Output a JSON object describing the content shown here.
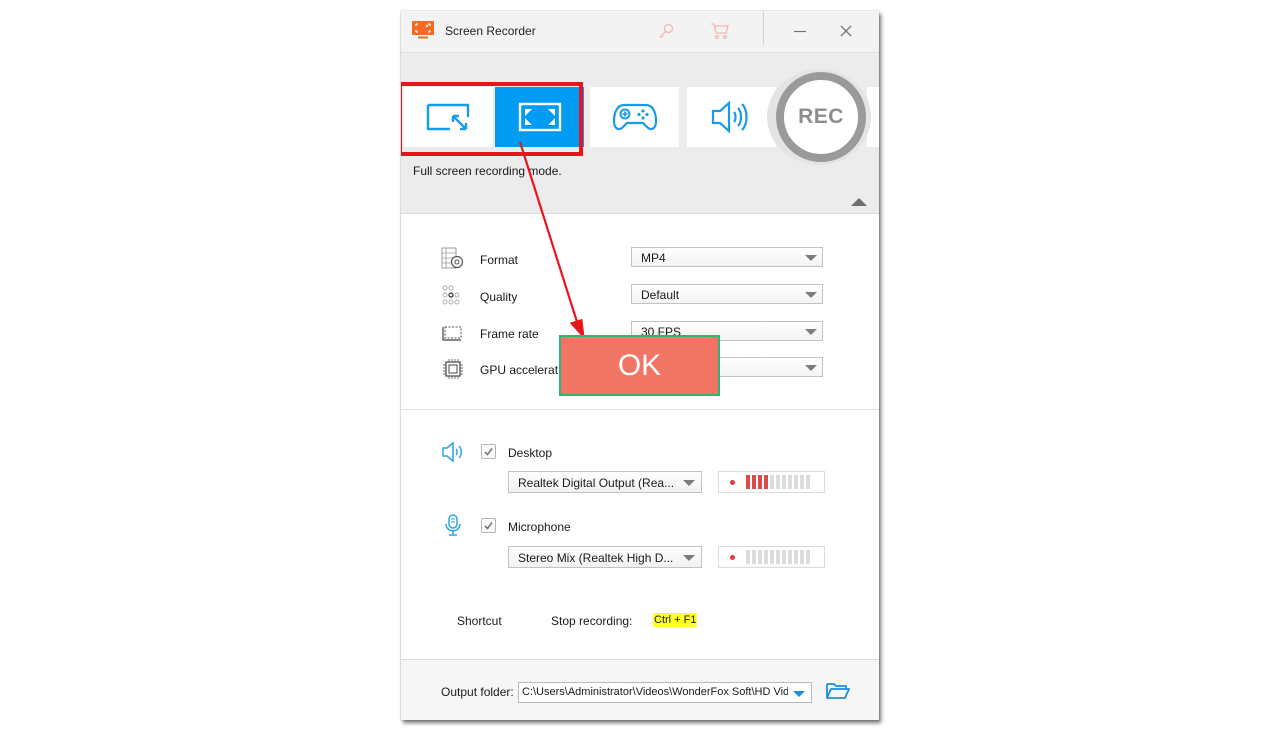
{
  "window": {
    "title": "Screen Recorder",
    "titlebar_icons": [
      "key-icon",
      "cart-icon",
      "minimize-icon",
      "close-icon"
    ]
  },
  "modes": {
    "items": [
      {
        "name": "region-mode",
        "icon": "region-resize-icon",
        "active": false
      },
      {
        "name": "fullscreen-mode",
        "icon": "fullscreen-icon",
        "active": true
      },
      {
        "name": "game-mode",
        "icon": "gamepad-icon",
        "active": false
      },
      {
        "name": "audio-mode",
        "icon": "speaker-icon",
        "active": false
      }
    ],
    "rec_label": "REC",
    "description": "Full screen recording mode."
  },
  "settings": {
    "format": {
      "label": "Format",
      "value": "MP4"
    },
    "quality": {
      "label": "Quality",
      "value": "Default"
    },
    "frame_rate": {
      "label": "Frame rate",
      "value": "30 FPS"
    },
    "gpu": {
      "label": "GPU accelerat",
      "value": ""
    }
  },
  "audio": {
    "desktop": {
      "label": "Desktop",
      "checked": true,
      "device": "Realtek Digital Output (Rea...",
      "level_segments_on": 4,
      "level_segments_total": 11
    },
    "microphone": {
      "label": "Microphone",
      "checked": true,
      "device": "Stereo Mix (Realtek High D...",
      "level_segments_on": 0,
      "level_segments_total": 11
    }
  },
  "shortcut": {
    "label": "Shortcut",
    "stop_label": "Stop recording:",
    "stop_key": "Ctrl + F1"
  },
  "output": {
    "label": "Output folder:",
    "path": "C:\\Users\\Administrator\\Videos\\WonderFox Soft\\HD Video"
  },
  "annotation": {
    "ok_label": "OK",
    "highlight_color": "#e8161c",
    "ok_bg": "#f07564",
    "ok_border": "#2bb673"
  },
  "colors": {
    "accent": "#009cf3",
    "brand_orange": "#f26b21"
  }
}
